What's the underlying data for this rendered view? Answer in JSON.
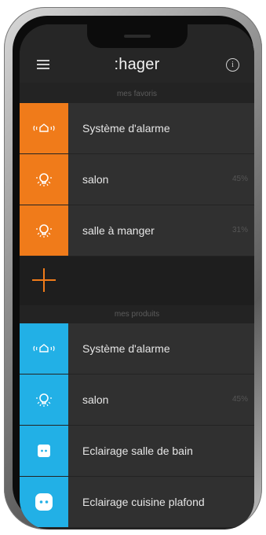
{
  "header": {
    "logo_text": ":hager",
    "menu_icon": "hamburger-menu-icon",
    "info_icon": "info-icon",
    "info_glyph": "i"
  },
  "favorites": {
    "title": "mes favoris",
    "items": [
      {
        "label": "Système d'alarme",
        "value": "",
        "icon": "alarm-icon"
      },
      {
        "label": "salon",
        "value": "45%",
        "icon": "light-bulb-icon"
      },
      {
        "label": "salle à manger",
        "value": "31%",
        "icon": "light-bulb-icon"
      }
    ],
    "add_icon": "plus-icon"
  },
  "products": {
    "title": "mes produits",
    "items": [
      {
        "label": "Système d'alarme",
        "value": "",
        "icon": "alarm-icon"
      },
      {
        "label": "salon",
        "value": "45%",
        "icon": "light-bulb-icon"
      },
      {
        "label": "Eclairage salle de bain",
        "value": "",
        "icon": "outlet-icon"
      },
      {
        "label": "Eclairage cuisine plafond",
        "value": "",
        "icon": "outlet-icon"
      }
    ]
  },
  "colors": {
    "favorites_accent": "#f07b1a",
    "products_accent": "#22b0e6",
    "background": "#232323"
  }
}
